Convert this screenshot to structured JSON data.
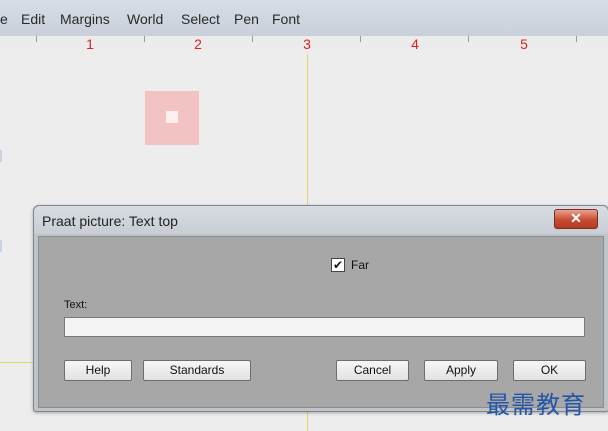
{
  "menubar": {
    "items": [
      "e",
      "Edit",
      "Margins",
      "World",
      "Select",
      "Pen",
      "Font"
    ]
  },
  "ruler": {
    "numbers": [
      "1",
      "2",
      "3",
      "4",
      "5"
    ]
  },
  "dialog": {
    "title": "Praat picture: Text top",
    "close_glyph": "✕",
    "checkbox": {
      "label": "Far",
      "checked": true,
      "check_glyph": "✔"
    },
    "text_field": {
      "label": "Text:",
      "value": ""
    },
    "buttons": {
      "help": "Help",
      "standards": "Standards",
      "cancel": "Cancel",
      "apply": "Apply",
      "ok": "OK"
    }
  },
  "watermark": "最需教育"
}
